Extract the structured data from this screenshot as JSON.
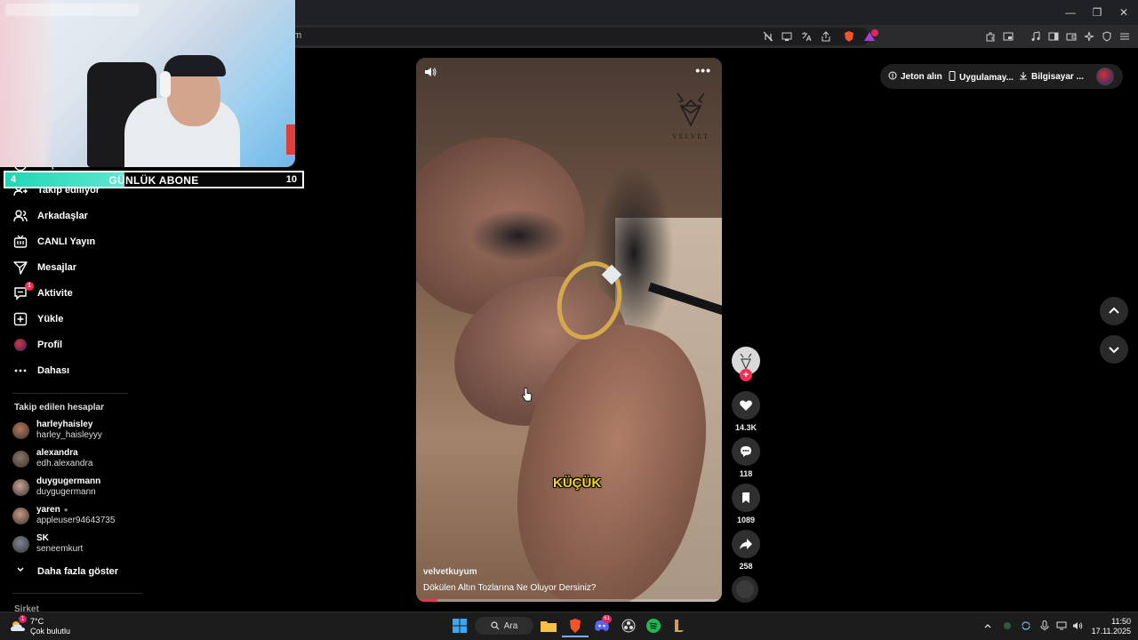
{
  "browser": {
    "url_fragment": "m",
    "window_controls": {
      "minimize": "—",
      "maximize": "❐",
      "close": "✕"
    }
  },
  "overlay": {
    "subscriber_goal": {
      "current": "4",
      "label": "GÜNLÜK ABONE",
      "target": "10",
      "progress_fraction": 0.4
    }
  },
  "sidebar": {
    "items": [
      {
        "label": "Keşfet",
        "icon": "compass-icon"
      },
      {
        "label": "Takip ediliyor",
        "icon": "following-icon"
      },
      {
        "label": "Arkadaşlar",
        "icon": "friends-icon"
      },
      {
        "label": "CANLI Yayın",
        "icon": "live-tv-icon"
      },
      {
        "label": "Mesajlar",
        "icon": "send-icon"
      },
      {
        "label": "Aktivite",
        "icon": "activity-icon",
        "badge": "1"
      },
      {
        "label": "Yükle",
        "icon": "upload-icon"
      },
      {
        "label": "Profil",
        "icon": "profile-avatar-icon"
      },
      {
        "label": "Dahası",
        "icon": "more-icon"
      }
    ],
    "following_title": "Takip edilen hesaplar",
    "following": [
      {
        "name": "harleyhaisley",
        "user": "harley_haisleyyy",
        "color": "#b5785c"
      },
      {
        "name": "alexandra",
        "user": "edh.alexandra",
        "color": "#8a7766"
      },
      {
        "name": "duygugermann",
        "user": "duygugermann",
        "color": "#c8a592"
      },
      {
        "name": "yaren",
        "user": "appleuser94643735",
        "color": "#c49a83",
        "verified": "●"
      },
      {
        "name": "SK",
        "user": "seneemkurt",
        "color": "#7d8792"
      }
    ],
    "show_more": "Daha fazla göster",
    "company": "Şirket"
  },
  "video": {
    "author": "velvetkuyum",
    "caption": "Dökülen Altın Tozlarına Ne Oluyor Dersiniz?",
    "overlay_text": "KÜÇÜK",
    "logo_text": "VELVET",
    "more": "•••",
    "progress_fraction": 0.07
  },
  "actions": {
    "likes": "14.3K",
    "comments": "118",
    "saves": "1089",
    "shares": "258",
    "follow_plus": "+"
  },
  "top_right": {
    "coins": "Jeton alın",
    "app": "Uygulamay...",
    "desktop": "Bilgisayar ..."
  },
  "taskbar": {
    "weather_temp": "7°C",
    "weather_desc": "Çok bulutlu",
    "weather_badge": "1",
    "search": "Ara",
    "time": "11:50",
    "date": "17.11.2025",
    "discord_badge": "61"
  },
  "colors": {
    "accent": "#fe2c55",
    "goal_fill": "#1fd7b3",
    "ring": "#d4a94d",
    "overlay_text": "#f5d91c"
  }
}
